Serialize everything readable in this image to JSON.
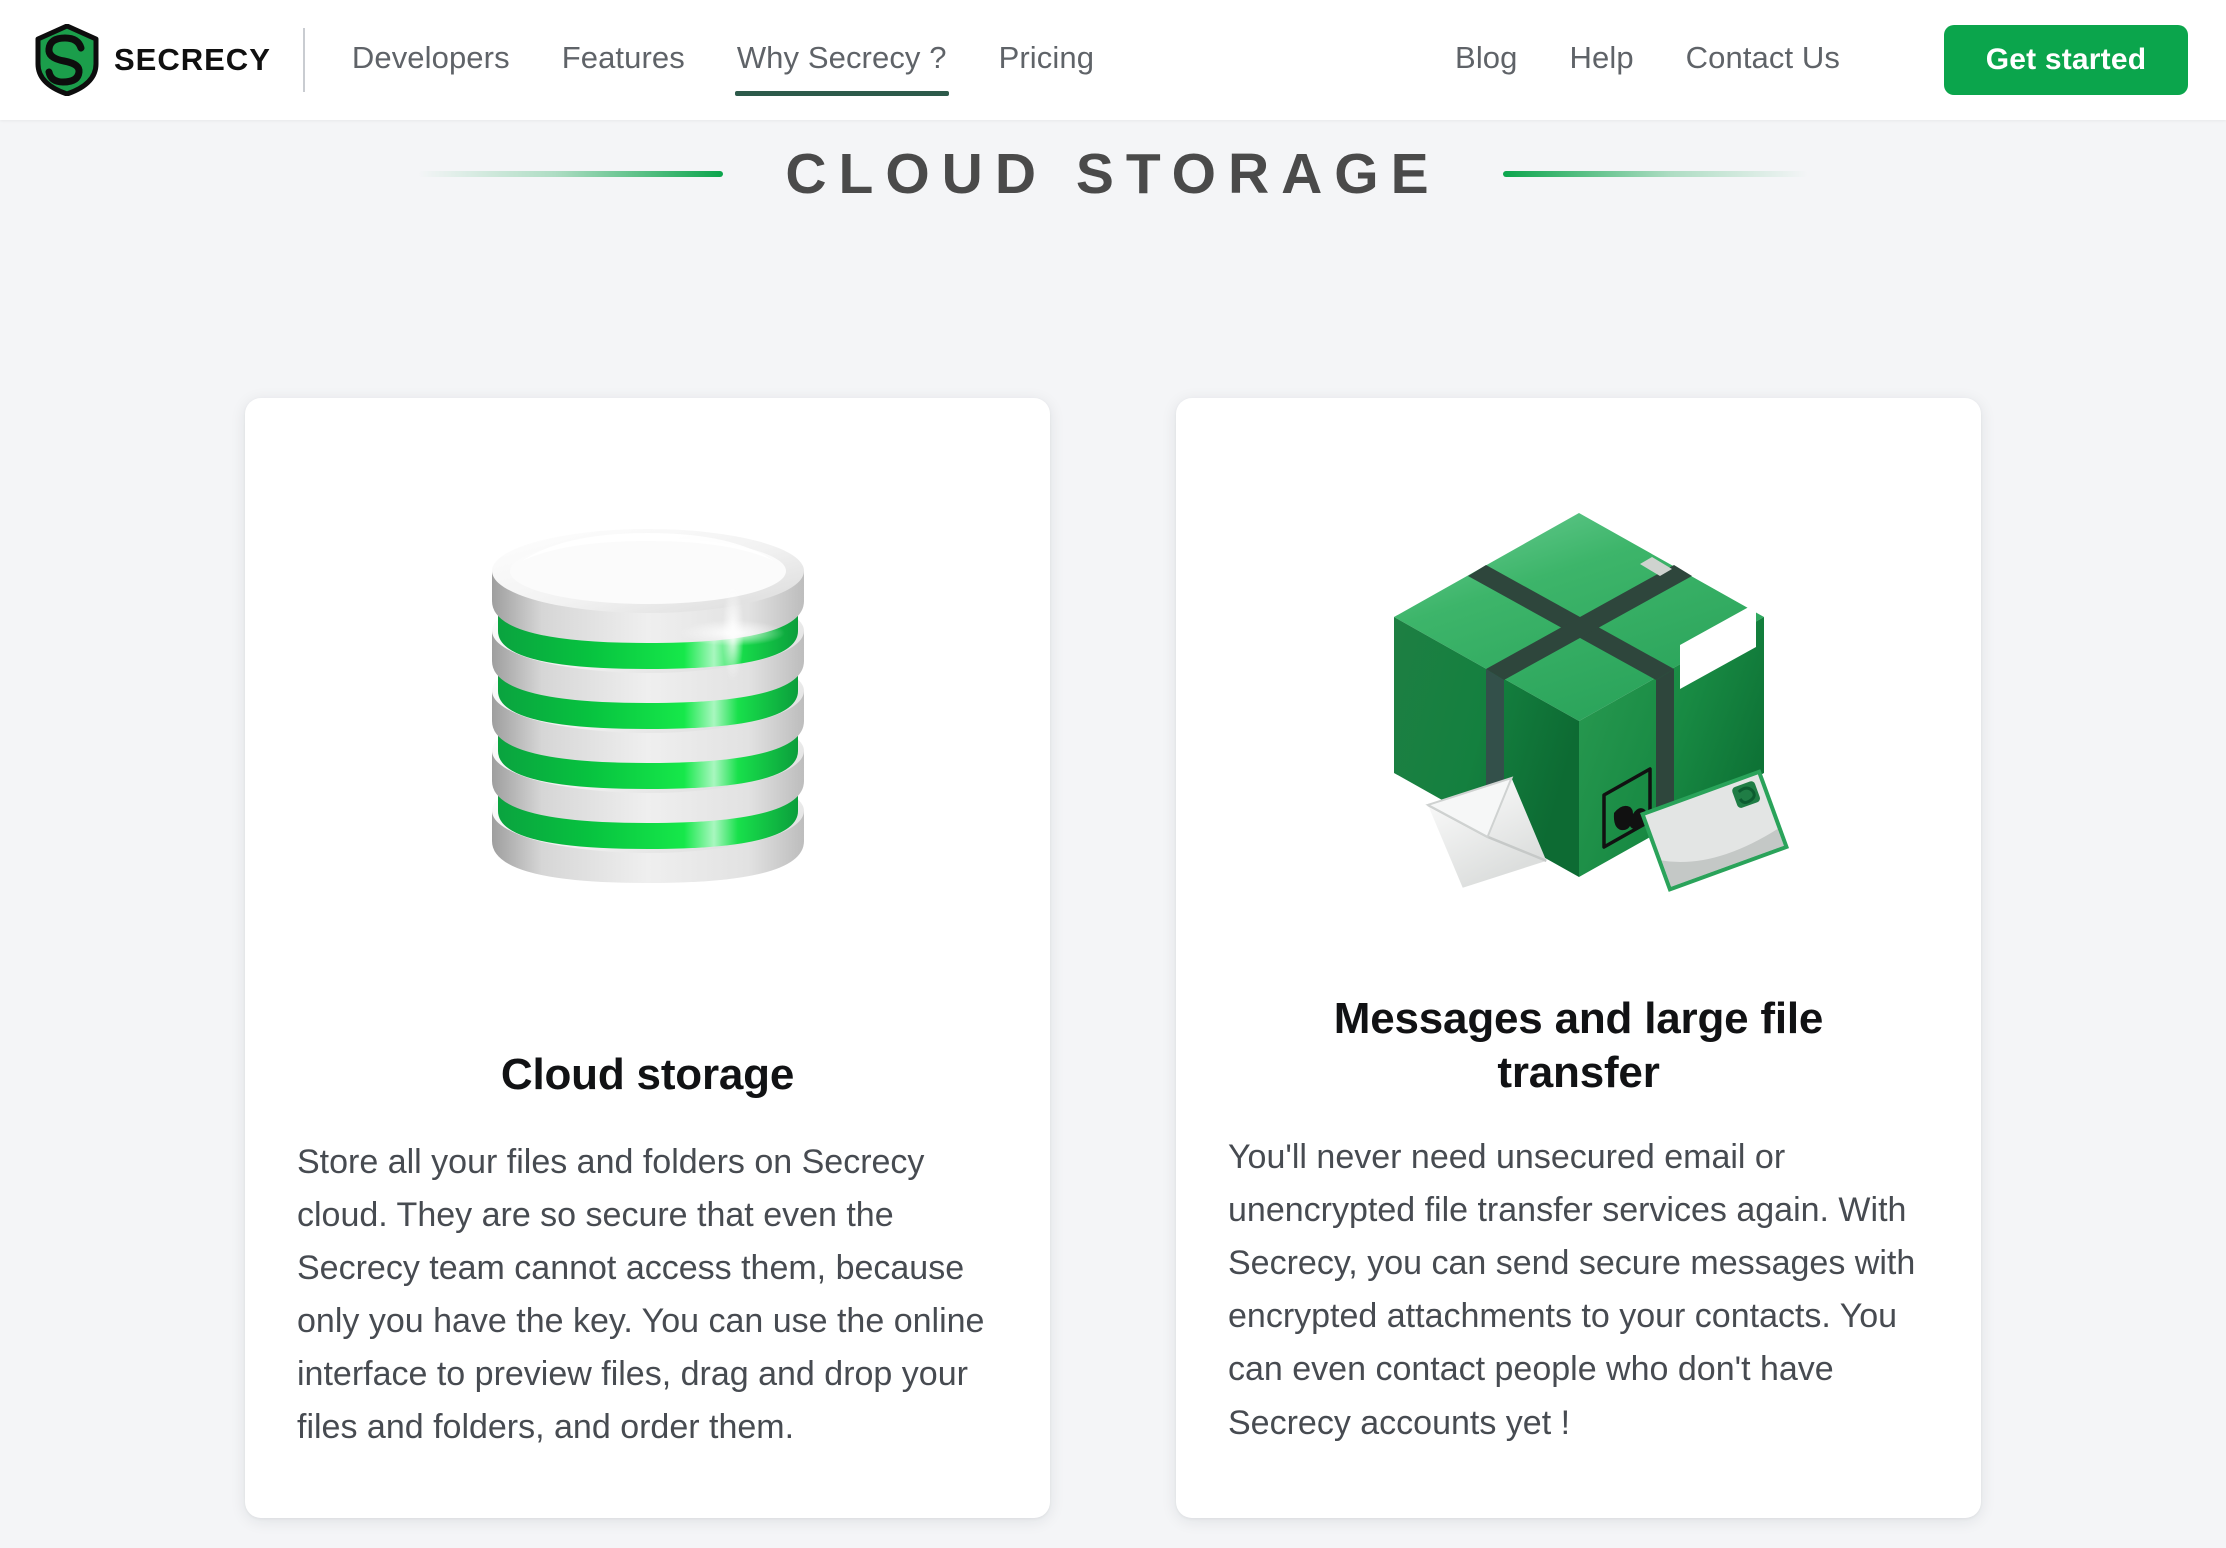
{
  "header": {
    "brand": {
      "name": "SECRECY",
      "logo_icon": "shield-s-logo-icon"
    },
    "nav_left": [
      {
        "label": "Developers",
        "active": false
      },
      {
        "label": "Features",
        "active": false
      },
      {
        "label": "Why Secrecy ?",
        "active": true
      },
      {
        "label": "Pricing",
        "active": false
      }
    ],
    "nav_right": [
      {
        "label": "Blog"
      },
      {
        "label": "Help"
      },
      {
        "label": "Contact Us"
      }
    ],
    "cta_label": "Get started",
    "accent_color": "#0ba54c",
    "active_underline_color": "#2d5a4a"
  },
  "section": {
    "title": "CLOUD STORAGE"
  },
  "cards": [
    {
      "illustration": "database-stack-icon",
      "title": "Cloud storage",
      "body": "Store all your files and folders on Secrecy cloud. They are so secure that even the Secrecy team cannot access them, because only you have the key. You can use the online interface to preview files, drag and drop your files and folders, and order them."
    },
    {
      "illustration": "package-box-icon",
      "title": "Messages and large file transfer",
      "body": "You'll never need unsecured email or unencrypted file transfer services again. With Secrecy, you can send secure messages with encrypted attachments to your contacts. You can even contact people who don't have Secrecy accounts yet !"
    }
  ]
}
